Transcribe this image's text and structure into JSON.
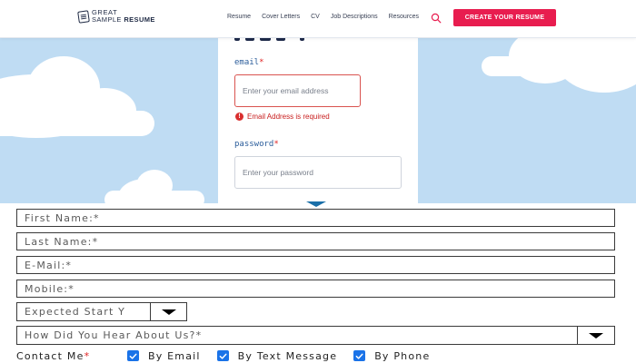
{
  "header": {
    "logo": {
      "line1": "GREAT",
      "line2_light": "SAMPLE",
      "line2_bold": "RESUME"
    },
    "nav": [
      {
        "label": "Resume"
      },
      {
        "label": "Cover Letters"
      },
      {
        "label": "CV"
      },
      {
        "label": "Job Descriptions"
      },
      {
        "label": "Resources"
      }
    ],
    "search_icon": "search-icon",
    "cta_label": "CREATE YOUR RESUME",
    "cta_color": "#e81d4f"
  },
  "login": {
    "email_label": "email",
    "email_required": "*",
    "email_placeholder": "Enter your email address",
    "email_error": "Email Address is required",
    "error_icon": "!",
    "password_label": "password",
    "password_required": "*",
    "password_placeholder": "Enter your password"
  },
  "form": {
    "first_name_placeholder": "First Name:*",
    "last_name_placeholder": "Last Name:*",
    "email_placeholder": "E-Mail:*",
    "mobile_placeholder": "Mobile:*",
    "start_select_value": "Expected Start Y",
    "hear_select_value": "How Did You Hear About Us?*",
    "contact_label": "Contact Me",
    "contact_required": "*",
    "contact_options": [
      {
        "label": "By Email",
        "checked": true
      },
      {
        "label": "By Text Message",
        "checked": true
      },
      {
        "label": "By Phone",
        "checked": true
      }
    ]
  },
  "colors": {
    "sky": "#bfdcf3",
    "checkbox": "#1a73e8",
    "error": "#c81e1e",
    "label_blue": "#2a5c9a"
  }
}
